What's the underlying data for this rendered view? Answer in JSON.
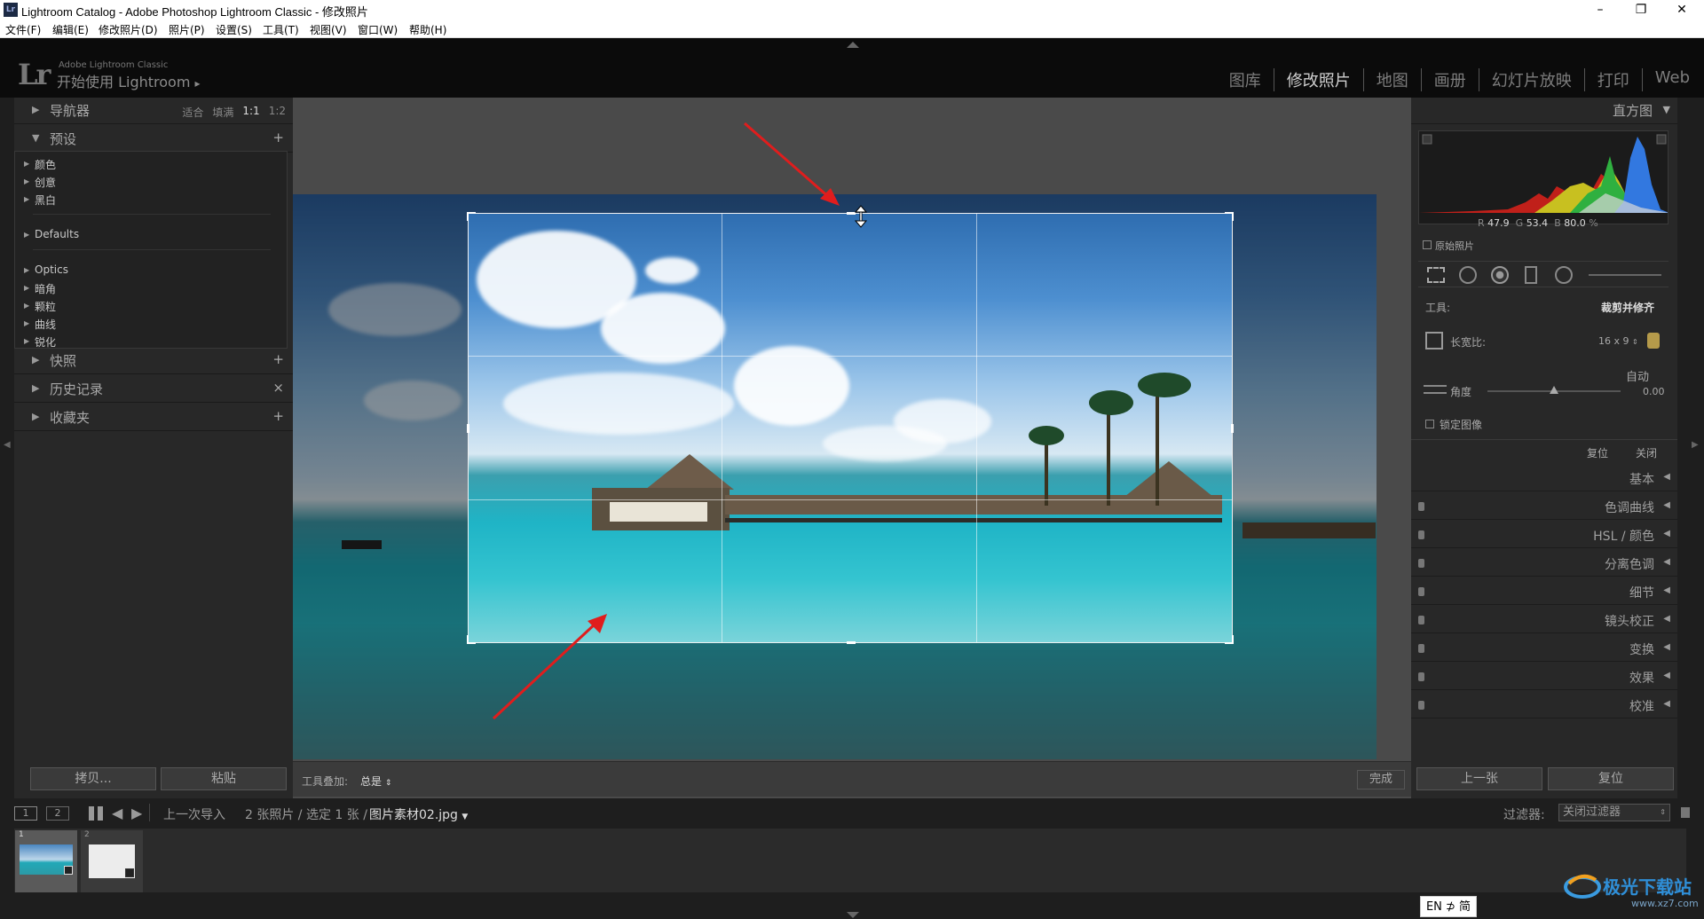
{
  "window": {
    "title": "Lightroom Catalog - Adobe Photoshop Lightroom Classic - 修改照片",
    "app_icon": "Lr",
    "controls": [
      "–",
      "❐",
      "✕"
    ]
  },
  "menu": [
    "文件(F)",
    "编辑(E)",
    "修改照片(D)",
    "照片(P)",
    "设置(S)",
    "工具(T)",
    "视图(V)",
    "窗口(W)",
    "帮助(H)"
  ],
  "identity": {
    "logo": "Lr",
    "product": "Adobe Lightroom Classic",
    "tagline": "开始使用 Lightroom",
    "tagline_arrow": "▸"
  },
  "modules": [
    "图库",
    "修改照片",
    "地图",
    "画册",
    "幻灯片放映",
    "打印",
    "Web"
  ],
  "active_module": "修改照片",
  "left_panel": {
    "navigator": {
      "label": "导航器",
      "options": [
        "适合",
        "填满",
        "1:1",
        "1:2"
      ],
      "selected": "1:1"
    },
    "presets": {
      "label": "预设",
      "add": "+",
      "groups": [
        "颜色",
        "创意",
        "黑白",
        "Defaults",
        "Optics",
        "暗角",
        "颗粒",
        "曲线",
        "锐化"
      ]
    },
    "snapshots": {
      "label": "快照",
      "action": "+"
    },
    "history": {
      "label": "历史记录",
      "action": "×"
    },
    "collections": {
      "label": "收藏夹",
      "action": "+"
    },
    "copy_button": "拷贝...",
    "paste_button": "粘贴"
  },
  "center": {
    "toolbar": {
      "overlay_label": "工具叠加:",
      "overlay_value": "总是",
      "done_button": "完成"
    }
  },
  "right_panel": {
    "histogram": {
      "label": "直方图",
      "readout": {
        "r_label": "R",
        "r": "47.9",
        "g_label": "G",
        "g": "53.4",
        "b_label": "B",
        "b": "80.0",
        "unit": "%"
      },
      "original_label": "原始照片"
    },
    "crop": {
      "tool_label": "工具:",
      "tool_name": "裁剪并修齐",
      "aspect_label": "长宽比:",
      "aspect_value": "16 x 9",
      "auto_label": "自动",
      "angle_label": "角度",
      "angle_value": "0.00",
      "angle_level": 0.5,
      "constrain_label": "锁定图像",
      "reset_label": "复位",
      "close_label": "关闭"
    },
    "panels": [
      "基本",
      "色调曲线",
      "HSL / 颜色",
      "分离色调",
      "细节",
      "镜头校正",
      "变换",
      "效果",
      "校准"
    ],
    "prev_button": "上一张",
    "reset_button": "复位"
  },
  "filmstrip": {
    "views": [
      "1",
      "2"
    ],
    "source": "上一次导入",
    "count": "2 张照片 / 选定 1 张 /",
    "filename": "图片素材02.jpg",
    "filter_label": "过滤器:",
    "filter_value": "关闭过滤器",
    "thumb_numbers": [
      "1",
      "2"
    ]
  },
  "ime": "EN ⊅ 简",
  "watermark": "极光下载站",
  "watermark_url": "www.xz7.com",
  "colors": {
    "accent_red": "#e01d1d",
    "panel": "#282828",
    "center_bg": "#4a4a4a"
  }
}
